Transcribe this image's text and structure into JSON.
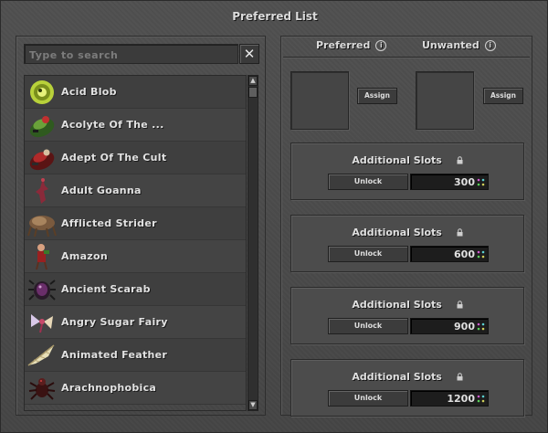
{
  "window": {
    "title": "Preferred List"
  },
  "search": {
    "placeholder": "Type to search",
    "clear_icon": "close-icon"
  },
  "creatures": [
    {
      "name": "Acid Blob",
      "icon": "acid-blob-icon",
      "color": "#b8d13a"
    },
    {
      "name": "Acolyte Of The ...",
      "icon": "acolyte-icon",
      "color": "#3f7a2a"
    },
    {
      "name": "Adept Of The Cult",
      "icon": "adept-icon",
      "color": "#8a1f1f"
    },
    {
      "name": "Adult Goanna",
      "icon": "goanna-icon",
      "color": "#8a2a3a"
    },
    {
      "name": "Afflicted Strider",
      "icon": "strider-icon",
      "color": "#8a6a4a"
    },
    {
      "name": "Amazon",
      "icon": "amazon-icon",
      "color": "#9a2020"
    },
    {
      "name": "Ancient Scarab",
      "icon": "scarab-icon",
      "color": "#6a2e6a"
    },
    {
      "name": "Angry Sugar Fairy",
      "icon": "fairy-icon",
      "color": "#c8a0c0"
    },
    {
      "name": "Animated Feather",
      "icon": "feather-icon",
      "color": "#d8d0a0"
    },
    {
      "name": "Arachnophobica",
      "icon": "spider-icon",
      "color": "#5a1e1e"
    }
  ],
  "columns": {
    "preferred": "Preferred",
    "unwanted": "Unwanted",
    "assign_label": "Assign"
  },
  "slot_packs": [
    {
      "title": "Additional Slots",
      "unlock_label": "Unlock",
      "price": "300"
    },
    {
      "title": "Additional Slots",
      "unlock_label": "Unlock",
      "price": "600"
    },
    {
      "title": "Additional Slots",
      "unlock_label": "Unlock",
      "price": "900"
    },
    {
      "title": "Additional Slots",
      "unlock_label": "Unlock",
      "price": "1200"
    }
  ],
  "colors": {
    "background": "#4a4a4a",
    "text": "#dcdcdc",
    "price_bg": "#1d1d1d"
  }
}
